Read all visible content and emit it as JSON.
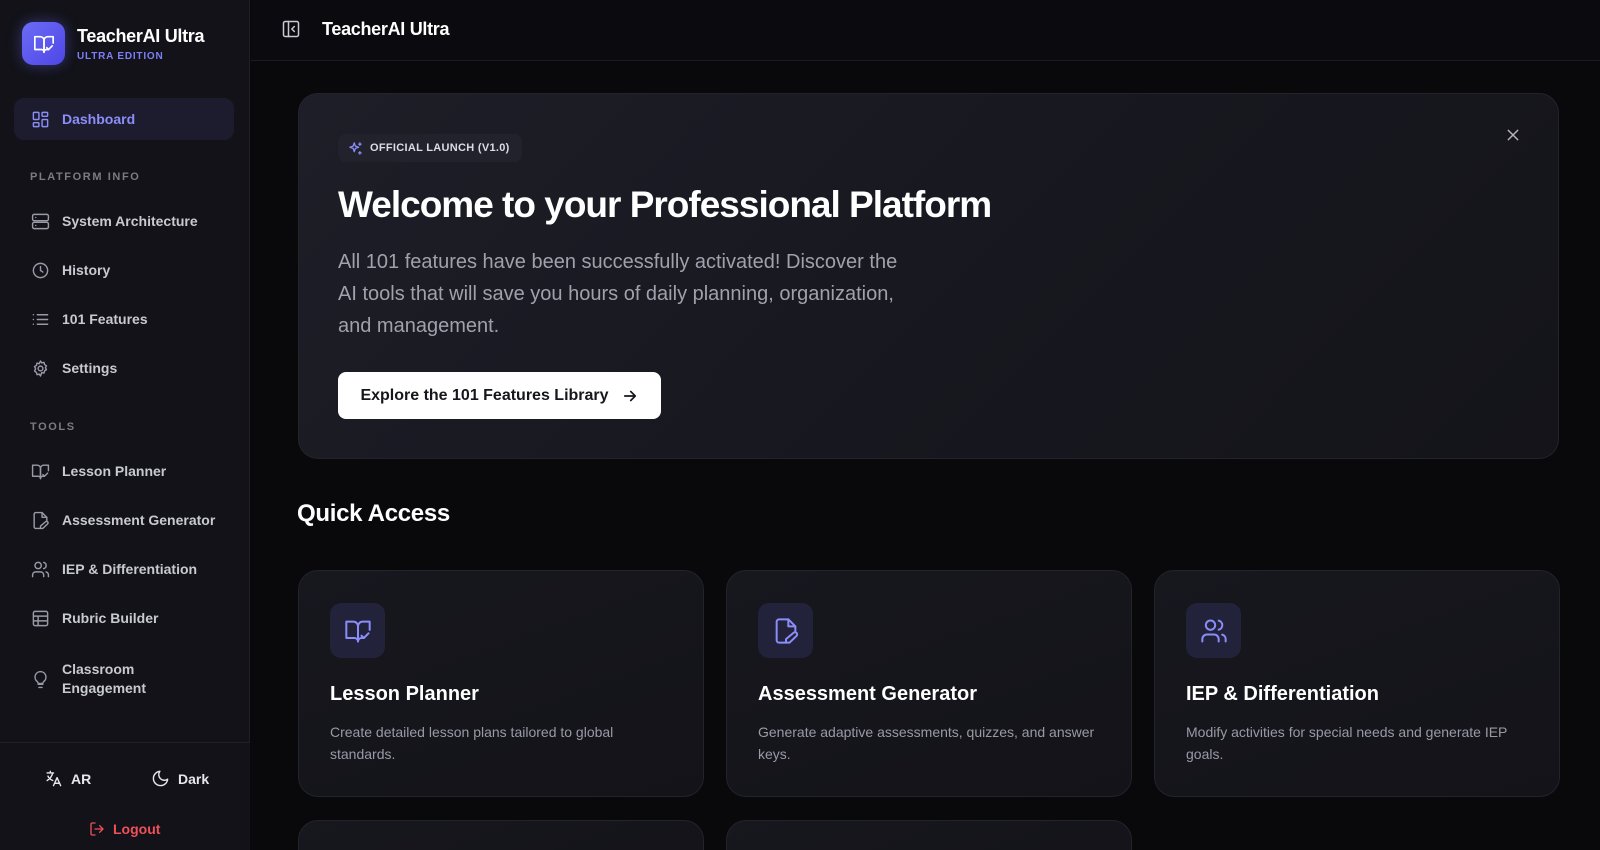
{
  "app": {
    "name": "TeacherAI Ultra",
    "edition": "ULTRA EDITION"
  },
  "sidebar": {
    "dashboard": "Dashboard",
    "platform_info_label": "PLATFORM INFO",
    "platform_items": [
      {
        "label": "System Architecture",
        "icon": "server-icon"
      },
      {
        "label": "History",
        "icon": "clock-icon"
      },
      {
        "label": "101 Features",
        "icon": "list-icon"
      },
      {
        "label": "Settings",
        "icon": "gear-icon"
      }
    ],
    "tools_label": "TOOLS",
    "tools_items": [
      {
        "label": "Lesson Planner",
        "icon": "book-check-icon"
      },
      {
        "label": "Assessment Generator",
        "icon": "file-pen-icon"
      },
      {
        "label": "IEP & Differentiation",
        "icon": "users-icon"
      },
      {
        "label": "Rubric Builder",
        "icon": "grid-icon"
      },
      {
        "label": "Classroom Engagement",
        "icon": "lightbulb-icon"
      }
    ],
    "footer": {
      "language": "AR",
      "theme": "Dark",
      "logout": "Logout"
    }
  },
  "topbar": {
    "title": "TeacherAI Ultra"
  },
  "hero": {
    "badge": "OFFICIAL LAUNCH (V1.0)",
    "title": "Welcome to your Professional Platform",
    "description": "All 101 features have been successfully activated! Discover the AI tools that will save you hours of daily planning, organization, and management.",
    "cta": "Explore the 101 Features Library"
  },
  "quick_access": {
    "title": "Quick Access",
    "cards": [
      {
        "title": "Lesson Planner",
        "description": "Create detailed lesson plans tailored to global standards.",
        "icon": "book-check-icon"
      },
      {
        "title": "Assessment Generator",
        "description": "Generate adaptive assessments, quizzes, and answer keys.",
        "icon": "file-pen-icon"
      },
      {
        "title": "IEP & Differentiation",
        "description": "Modify activities for special needs and generate IEP goals.",
        "icon": "users-icon"
      }
    ]
  },
  "colors": {
    "accent": "#6366f1",
    "accent_text": "#8b8ef9",
    "logout": "#f0505a",
    "background": "#09090c"
  }
}
